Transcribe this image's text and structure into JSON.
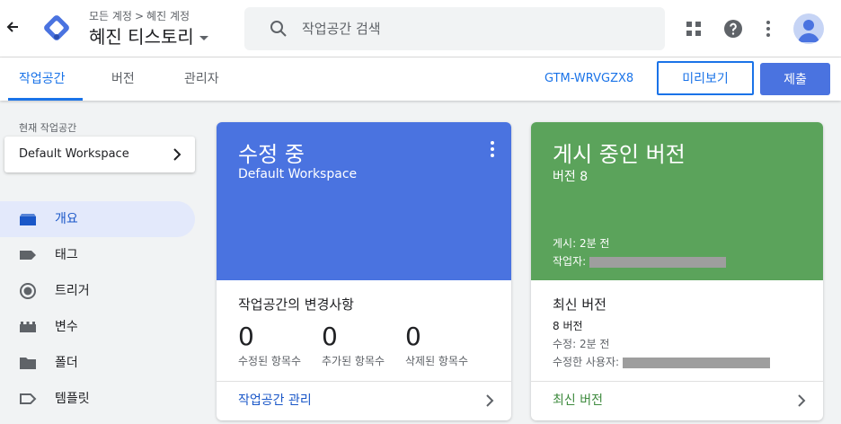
{
  "header": {
    "back_icon": "arrow-left-icon",
    "breadcrumb": {
      "account_all": "모든 계정",
      "separator": ">",
      "account": "혜진 계정"
    },
    "container_name": "혜진 티스토리",
    "search": {
      "placeholder": "작업공간 검색"
    },
    "icons": [
      "apps-grid-icon",
      "help-icon",
      "more-vert-icon",
      "avatar-icon"
    ]
  },
  "tabs": [
    {
      "label": "작업공간",
      "active": true
    },
    {
      "label": "버전",
      "active": false
    },
    {
      "label": "관리자",
      "active": false
    }
  ],
  "toolbar": {
    "container_id": "GTM-WRVGZX8",
    "preview_label": "미리보기",
    "submit_label": "제출"
  },
  "sidebar": {
    "workspace_label": "현재 작업공간",
    "workspace_name": "Default Workspace",
    "items": [
      {
        "label": "개요",
        "icon": "overview-icon",
        "active": true
      },
      {
        "label": "태그",
        "icon": "tag-icon",
        "active": false
      },
      {
        "label": "트리거",
        "icon": "trigger-icon",
        "active": false
      },
      {
        "label": "변수",
        "icon": "variable-icon",
        "active": false
      },
      {
        "label": "폴더",
        "icon": "folder-icon",
        "active": false
      },
      {
        "label": "템플릿",
        "icon": "template-icon",
        "active": false
      }
    ]
  },
  "editing_card": {
    "title": "수정 중",
    "subtitle": "Default Workspace",
    "changes_title": "작업공간의 변경사항",
    "counts": [
      {
        "value": "0",
        "label": "수정된 항목수"
      },
      {
        "value": "0",
        "label": "추가된 항목수"
      },
      {
        "value": "0",
        "label": "삭제된 항목수"
      }
    ],
    "footer_link": "작업공간 관리",
    "color": "#4a73e0"
  },
  "live_card": {
    "title": "게시 중인 버전",
    "subtitle": "버전 8",
    "published_label": "게시: 2분 전",
    "publisher_label": "작업자:",
    "latest_title": "최신 버전",
    "latest_version": "8 버전",
    "modified_label": "수정: 2분 전",
    "modified_by_label": "수정한 사용자:",
    "footer_link": "최신 버전",
    "color": "#5ba35b"
  }
}
